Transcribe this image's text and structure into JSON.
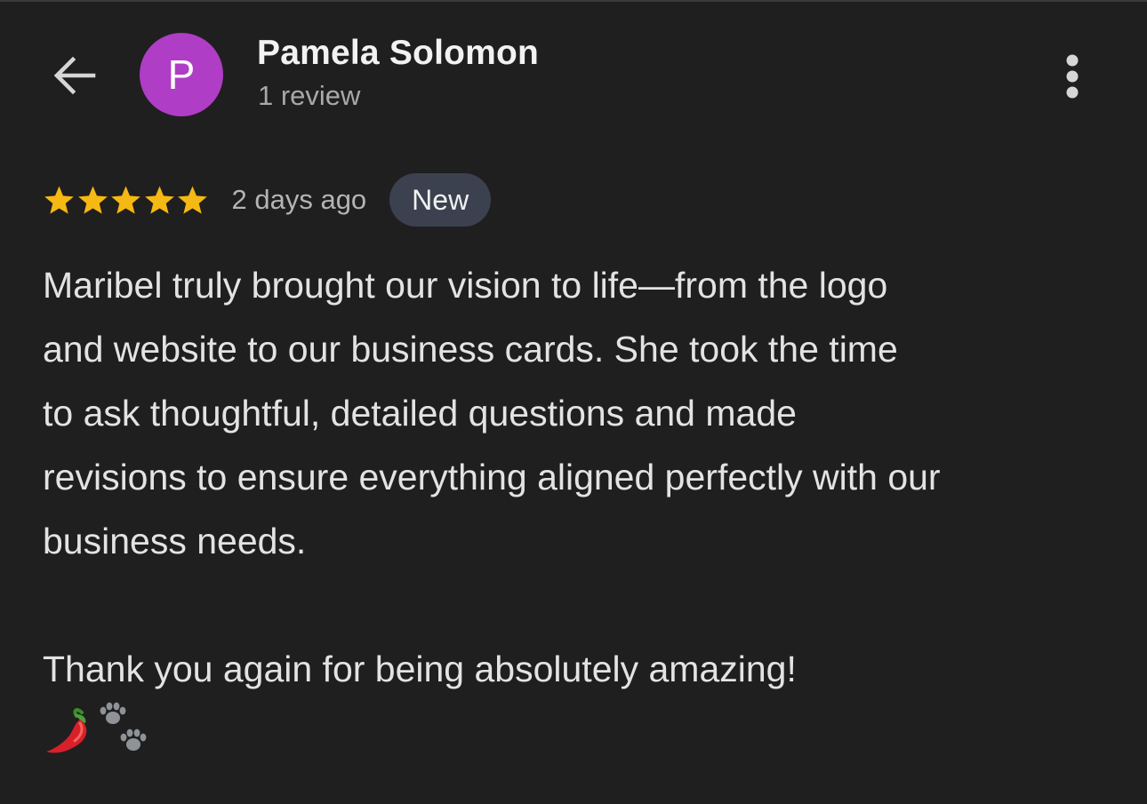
{
  "header": {
    "back_icon": "arrow-left-icon",
    "avatar_initial": "P",
    "avatar_color": "#b03dc6",
    "reviewer_name": "Pamela Solomon",
    "review_count": "1 review",
    "more_icon": "more-vert-icon"
  },
  "review": {
    "rating": 5,
    "rating_max": 5,
    "star_color": "#f6b812",
    "date": "2 days ago",
    "badge": "New",
    "body": "Maribel truly brought our vision to life—from the logo\nand website to our business cards. She took the time\nto ask thoughtful, detailed questions and made\nrevisions to ensure everything aligned perfectly with our\nbusiness needs.\n\nThank you again for being absolutely amazing!",
    "emojis": [
      "hot-pepper-icon",
      "paw-prints-icon"
    ]
  }
}
